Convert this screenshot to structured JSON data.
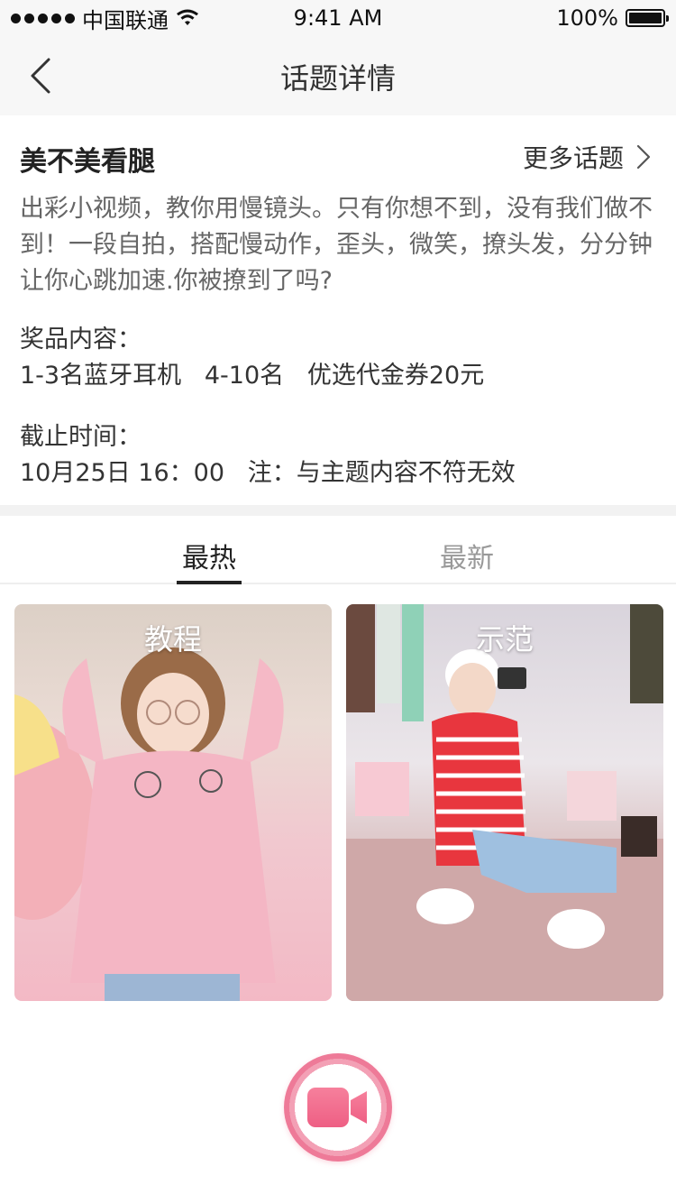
{
  "status_bar": {
    "carrier": "中国联通",
    "time": "9:41 AM",
    "battery": "100%"
  },
  "nav": {
    "title": "话题详情"
  },
  "topic": {
    "name": "美不美看腿",
    "more_label": "更多话题",
    "description": "出彩小视频，教你用慢镜头。只有你想不到，没有我们做不到！一段自拍，搭配慢动作，歪头，微笑，撩头发，分分钟让你心跳加速.你被撩到了吗?",
    "prize_label": "奖品内容：",
    "prize_value": "1-3名蓝牙耳机   4-10名   优选代金券20元",
    "deadline_label": "截止时间：",
    "deadline_value": "10月25日 16：00   注：与主题内容不符无效"
  },
  "tabs": [
    {
      "label": "最热"
    },
    {
      "label": "最新"
    }
  ],
  "cards": [
    {
      "title": "教程"
    },
    {
      "title": "示范"
    }
  ],
  "colors": {
    "accent": "#ee6e8c",
    "nav_bg": "#f7f7f7"
  }
}
